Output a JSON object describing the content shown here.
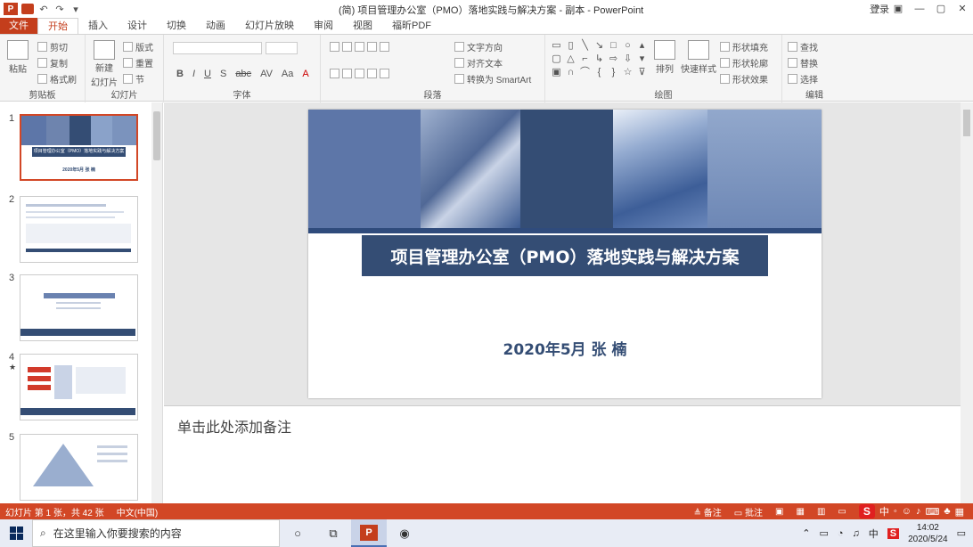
{
  "window": {
    "title": "(简) 项目管理办公室（PMO）落地实践与解决方案 - 副本 - PowerPoint",
    "signin": "登录",
    "controls": [
      "?",
      "▣",
      "—",
      "▢",
      "✕"
    ]
  },
  "qat": {
    "logo": "P",
    "undo": "↶",
    "redo": "↷",
    "extra": "▾"
  },
  "tabs": [
    "文件",
    "开始",
    "插入",
    "设计",
    "切换",
    "动画",
    "幻灯片放映",
    "审阅",
    "视图",
    "福昕PDF"
  ],
  "ribbon": {
    "clipboard": {
      "label": "剪贴板",
      "paste": "粘贴",
      "cut": "剪切",
      "copy": "复制",
      "format": "格式刷"
    },
    "slides": {
      "label": "幻灯片",
      "new": "新建",
      "new2": "幻灯片",
      "layout": "版式",
      "reset": "重置",
      "section": "节"
    },
    "font": {
      "label": "字体",
      "b": "B",
      "i": "I",
      "u": "U",
      "s": "S",
      "abc": "abc",
      "av": "AV",
      "aa": "Aa",
      "a": "A"
    },
    "paragraph": {
      "label": "段落",
      "dir": "文字方向",
      "align": "对齐文本",
      "smartart": "转换为 SmartArt"
    },
    "drawing": {
      "label": "绘图",
      "arrange": "排列",
      "quickstyle": "快速样式",
      "fill": "形状填充",
      "outline": "形状轮廓",
      "effect": "形状效果"
    },
    "edit": {
      "label": "编辑",
      "find": "查找",
      "replace": "替换",
      "select": "选择"
    }
  },
  "thumbnails": [
    {
      "num": "1",
      "title_line": "项目管理办公室（PMO）落地实践与解决方案",
      "sub": "2020年5月  张  楠"
    },
    {
      "num": "2"
    },
    {
      "num": "3"
    },
    {
      "num": "4",
      "star": "★"
    },
    {
      "num": "5"
    }
  ],
  "slide": {
    "title": "项目管理办公室（PMO）落地实践与解决方案",
    "subtitle": "2020年5月  张  楠"
  },
  "notes": {
    "placeholder": "单击此处添加备注"
  },
  "status": {
    "slide_info": "幻灯片 第 1 张，共 42 张",
    "language": "中文(中国)",
    "notes_btn": "备注",
    "comments_btn": "批注"
  },
  "ime": {
    "logo": "S",
    "mode": "中"
  },
  "taskbar": {
    "search_placeholder": "在这里输入你要搜索的内容",
    "ime_mode": "中",
    "time": "14:02",
    "date": "2020/5/24"
  }
}
